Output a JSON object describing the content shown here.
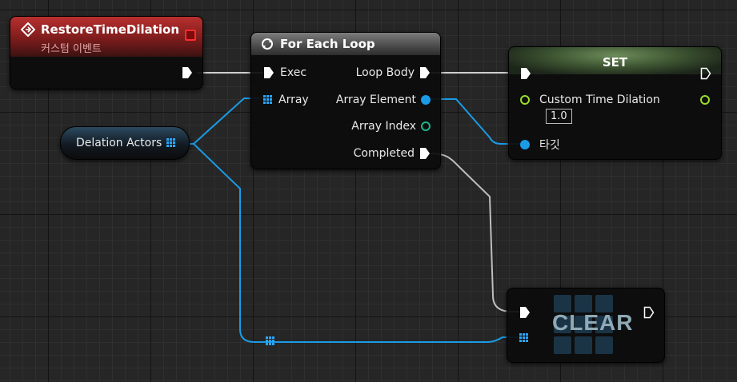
{
  "event_node": {
    "title": "RestoreTimeDilation",
    "subtitle": "커스텀 이벤트",
    "icon": "event-diamond-icon"
  },
  "variable_node": {
    "label": "Delation Actors",
    "pin_icon": "array-grid-icon"
  },
  "foreach_node": {
    "title": "For Each Loop",
    "icon": "loop-arrows-icon",
    "inputs": {
      "exec": "Exec",
      "array": "Array"
    },
    "outputs": {
      "loop_body": "Loop Body",
      "array_element": "Array Element",
      "array_index": "Array Index",
      "completed": "Completed"
    }
  },
  "set_node": {
    "title": "SET",
    "property_label": "Custom Time Dilation",
    "property_value": "1.0",
    "target_label": "타깃"
  },
  "clear_node": {
    "label": "CLEAR"
  },
  "colors": {
    "exec_wire": "#c8c8c8",
    "array_wire": "#1a9be6",
    "float_pin": "#9bdd28",
    "int_pin": "#1fb38a",
    "object_pin": "#1a9be6",
    "event_header": "#b8302f",
    "set_header": "#5c7a4a"
  }
}
